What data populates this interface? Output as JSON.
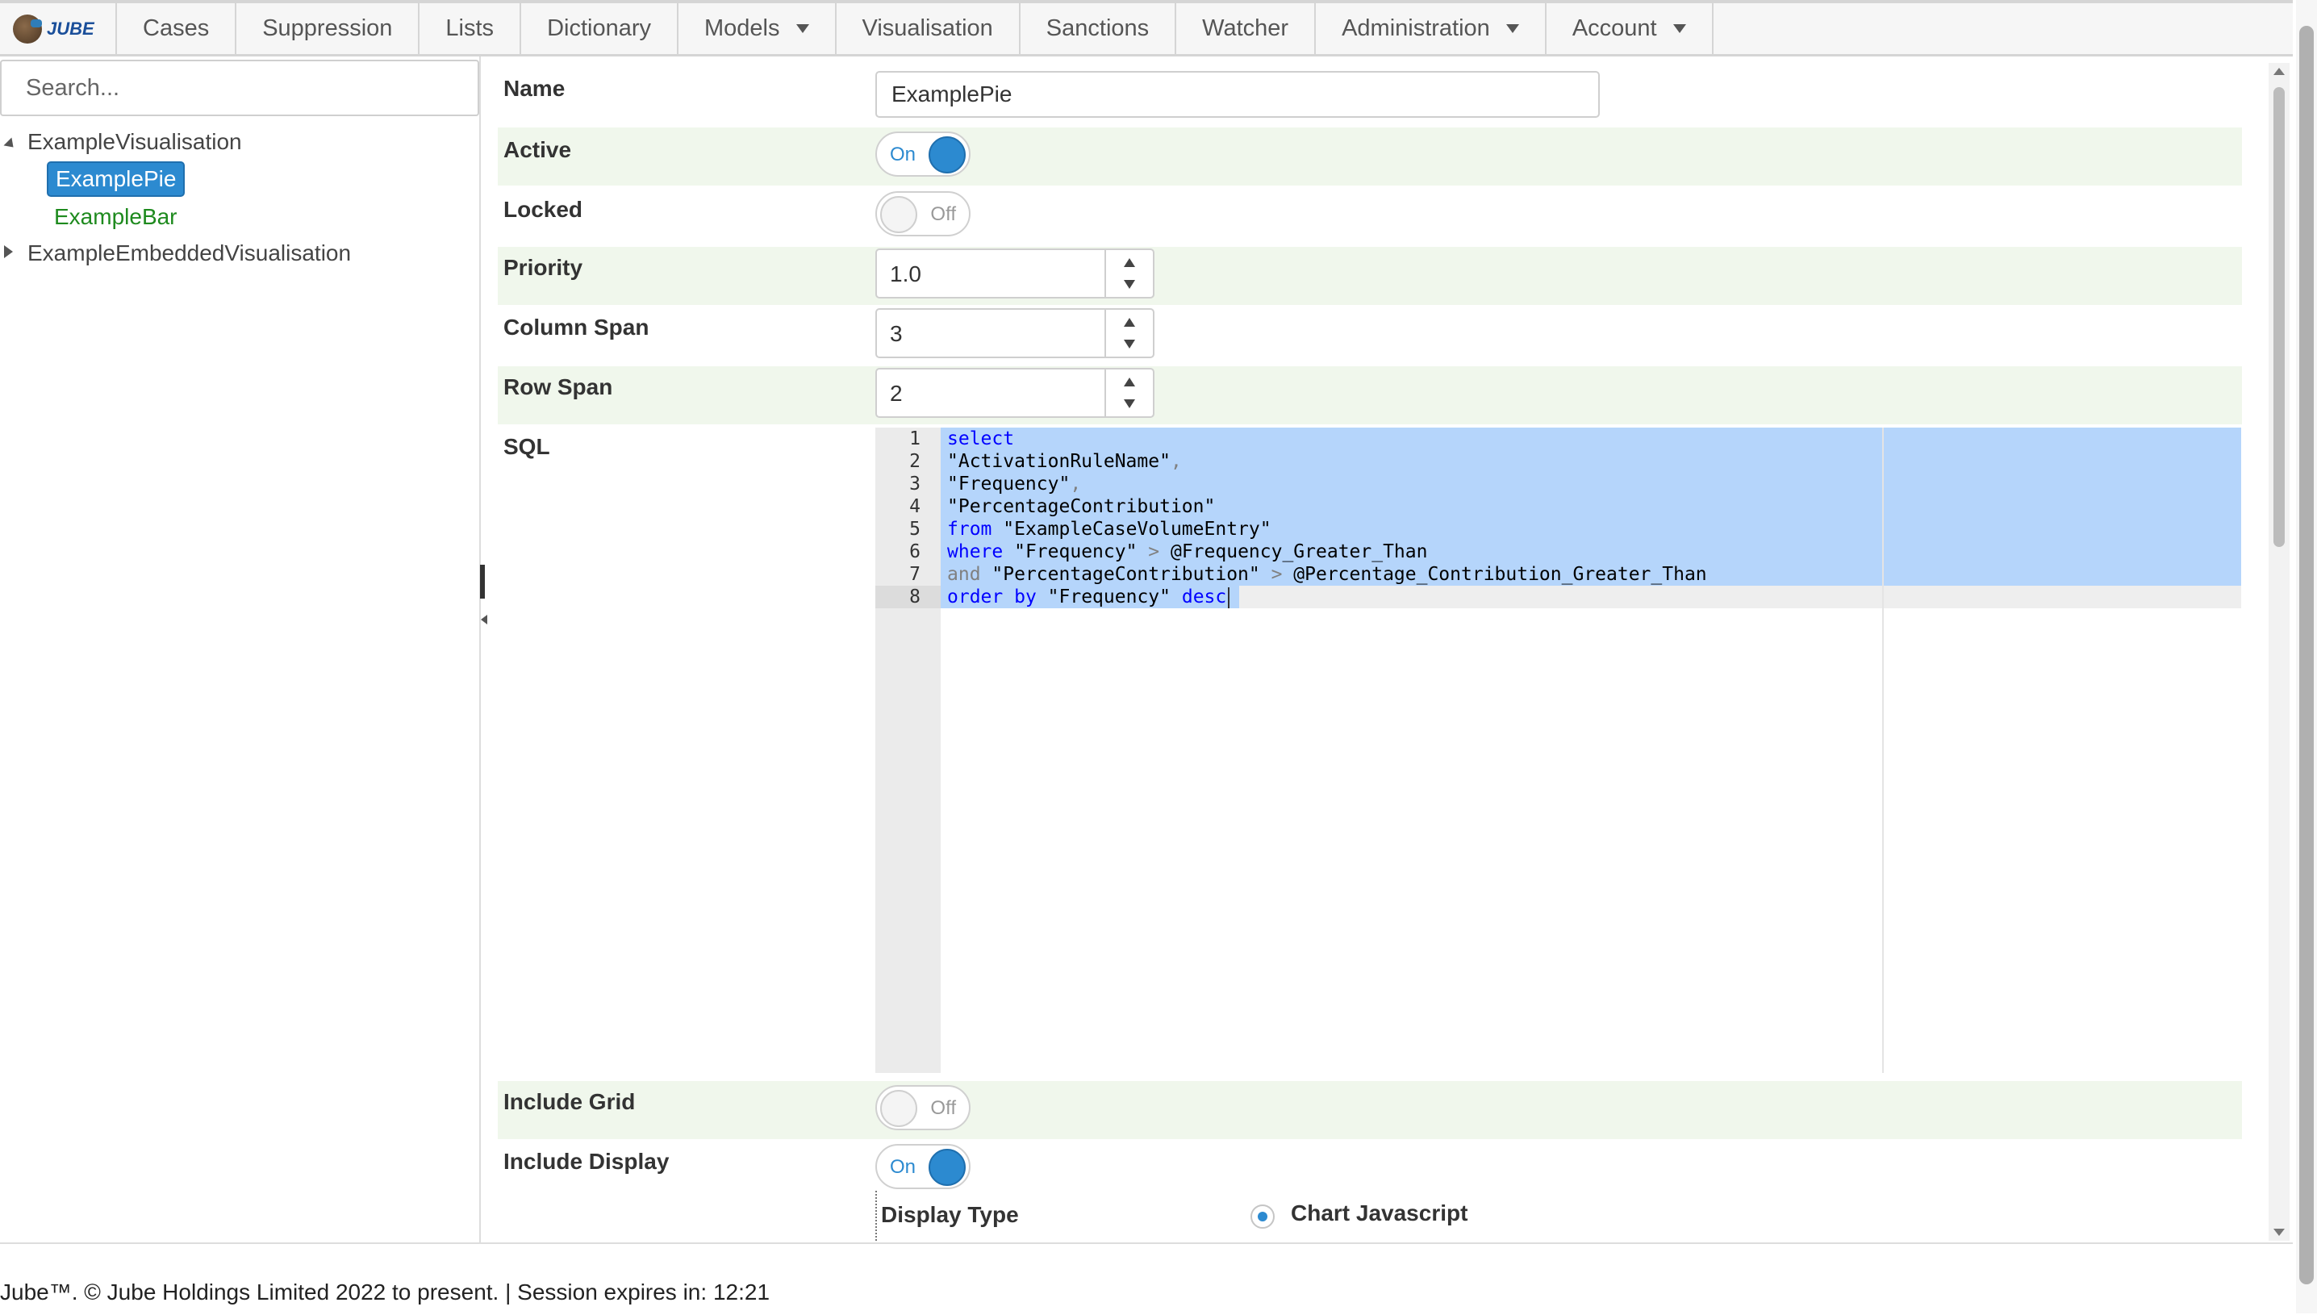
{
  "nav": {
    "logo_text": "JUBE",
    "items": [
      {
        "label": "Cases",
        "dropdown": false
      },
      {
        "label": "Suppression",
        "dropdown": false
      },
      {
        "label": "Lists",
        "dropdown": false
      },
      {
        "label": "Dictionary",
        "dropdown": false
      },
      {
        "label": "Models",
        "dropdown": true
      },
      {
        "label": "Visualisation",
        "dropdown": false
      },
      {
        "label": "Sanctions",
        "dropdown": false
      },
      {
        "label": "Watcher",
        "dropdown": false
      },
      {
        "label": "Administration",
        "dropdown": true
      },
      {
        "label": "Account",
        "dropdown": true
      }
    ]
  },
  "sidebar": {
    "search_placeholder": "Search...",
    "tree": [
      {
        "label": "ExampleVisualisation",
        "expanded": true,
        "children": [
          {
            "label": "ExamplePie",
            "selected": true
          },
          {
            "label": "ExampleBar",
            "selected": false
          }
        ]
      },
      {
        "label": "ExampleEmbeddedVisualisation",
        "expanded": false
      }
    ]
  },
  "form": {
    "name": {
      "label": "Name",
      "value": "ExamplePie"
    },
    "active": {
      "label": "Active",
      "state": "On"
    },
    "locked": {
      "label": "Locked",
      "state": "Off"
    },
    "priority": {
      "label": "Priority",
      "value": "1.0"
    },
    "column_span": {
      "label": "Column Span",
      "value": "3"
    },
    "row_span": {
      "label": "Row Span",
      "value": "2"
    },
    "sql": {
      "label": "SQL",
      "line_numbers": [
        "1",
        "2",
        "3",
        "4",
        "5",
        "6",
        "7",
        "8"
      ],
      "lines": [
        "select",
        "\"ActivationRuleName\",",
        "\"Frequency\",",
        "\"PercentageContribution\"",
        "from \"ExampleCaseVolumeEntry\"",
        "where \"Frequency\" > @Frequency_Greater_Than",
        "and \"PercentageContribution\" > @Percentage_Contribution_Greater_Than",
        "order by \"Frequency\" desc"
      ]
    },
    "include_grid": {
      "label": "Include Grid",
      "state": "Off"
    },
    "include_display": {
      "label": "Include Display",
      "state": "On"
    },
    "display_type": {
      "label": "Display Type",
      "option": "Chart Javascript"
    }
  },
  "footer": {
    "text": "Jube™. © Jube Holdings Limited 2022 to present.  |  Session expires in: 12:21"
  },
  "colors": {
    "accent": "#2c8ad0",
    "row_shade": "#f0f7ec",
    "selection": "#b5d5fb",
    "keyword": "#0000ff",
    "tree_green": "#1e8a1e"
  }
}
